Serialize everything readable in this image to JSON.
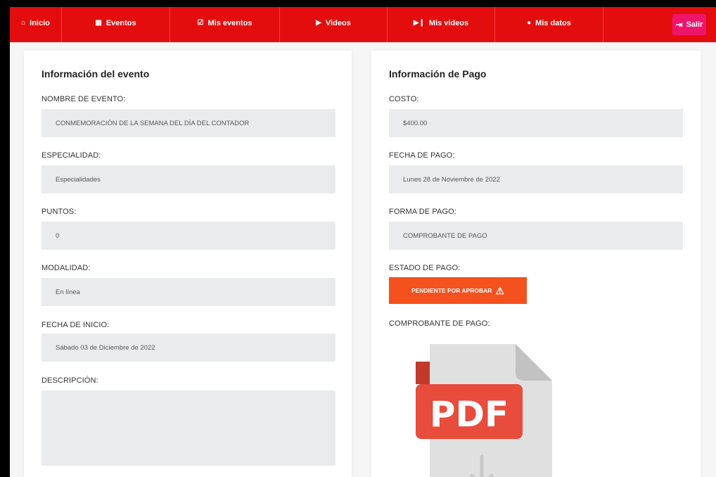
{
  "nav": {
    "items": [
      {
        "label": "Inicio",
        "icon": "home-icon",
        "glyph": "🏠︎"
      },
      {
        "label": "Eventos",
        "icon": "calendar-icon",
        "glyph": "▦"
      },
      {
        "label": "Mis eventos",
        "icon": "calendar-check-icon",
        "glyph": "☑"
      },
      {
        "label": "Videos",
        "icon": "play-icon",
        "glyph": "▶"
      },
      {
        "label": "Mis videos",
        "icon": "play-pause-icon",
        "glyph": "⏯"
      },
      {
        "label": "Mis datos",
        "icon": "user-circle-icon",
        "glyph": "●"
      }
    ],
    "logout": {
      "label": "Salir",
      "icon": "sign-out-icon",
      "glyph": "⇥"
    }
  },
  "event": {
    "title": "Información del evento",
    "name_label": "NOMBRE DE EVENTO:",
    "name_value": "CONMEMORACIÓN DE LA SEMANA DEL DÍA DEL CONTADOR",
    "specialty_label": "ESPECIALIDAD:",
    "specialty_value": "Especialidades",
    "points_label": "PUNTOS:",
    "points_value": "0",
    "modality_label": "MODALIDAD:",
    "modality_value": "En línea",
    "start_label": "FECHA DE INICIO:",
    "start_value": "Sábado 03 de Diciembre de 2022",
    "description_label": "DESCRIPCIÓN:",
    "description_value": ""
  },
  "payment": {
    "title": "Información de Pago",
    "cost_label": "COSTO:",
    "cost_value": "$400.00",
    "date_label": "FECHA DE PAGO:",
    "date_value": "Lunes 28 de Noviembre de 2022",
    "method_label": "FORMA DE PAGO:",
    "method_value": "COMPROBANTE DE PAGO",
    "status_label": "ESTADO DE PAGO:",
    "status_value": "PENDIENTE POR APROBAR",
    "receipt_label": "COMPROBANTE DE PAGO:",
    "pdf_text": "PDF"
  },
  "colors": {
    "navbar": "#e40d0d",
    "logout": "#f0146a",
    "status": "#f4511e",
    "pdf_red": "#e74c3c"
  }
}
